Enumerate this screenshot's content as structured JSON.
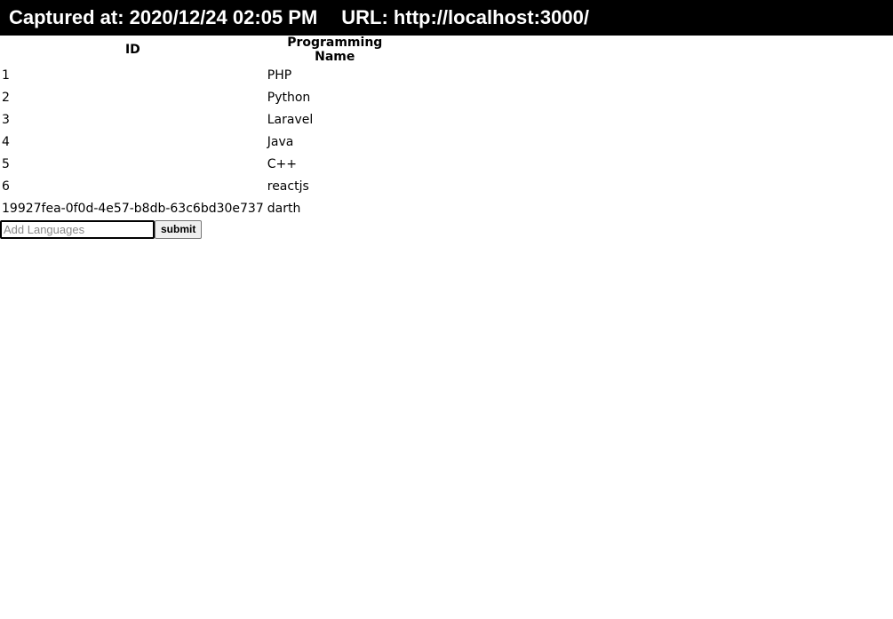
{
  "capture_bar": {
    "captured_label": "Captured at: 2020/12/24 02:05 PM",
    "url_label": "URL: http://localhost:3000/"
  },
  "table": {
    "headers": [
      "ID",
      "Programming Name"
    ],
    "rows": [
      {
        "id": "1",
        "name": "PHP"
      },
      {
        "id": "2",
        "name": "Python"
      },
      {
        "id": "3",
        "name": "Laravel"
      },
      {
        "id": "4",
        "name": "Java"
      },
      {
        "id": "5",
        "name": "C++"
      },
      {
        "id": "6",
        "name": "reactjs"
      },
      {
        "id": "19927fea-0f0d-4e57-b8db-63c6bd30e737",
        "name": "darth"
      }
    ]
  },
  "form": {
    "input_placeholder": "Add Languages",
    "input_value": "",
    "submit_label": "submit"
  }
}
